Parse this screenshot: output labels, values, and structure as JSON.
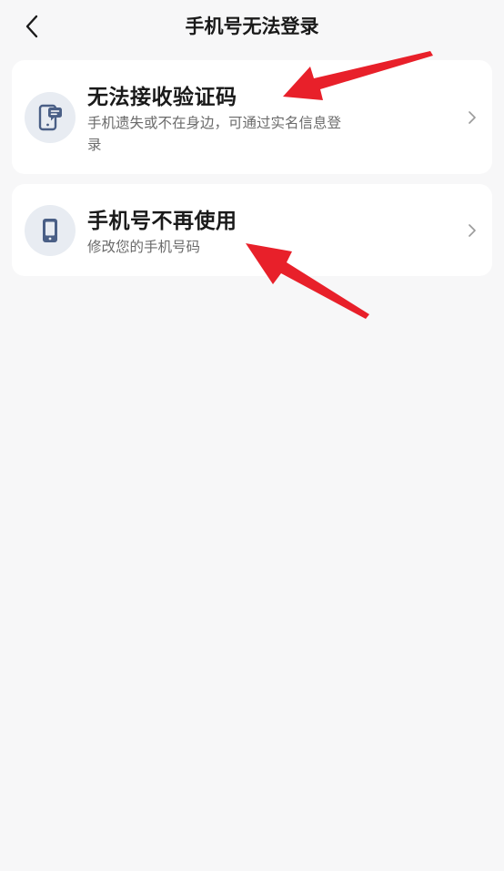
{
  "header": {
    "title": "手机号无法登录"
  },
  "options": [
    {
      "title": "无法接收验证码",
      "description": "手机遗失或不在身边，可通过实名信息登录",
      "icon": "phone-message-icon"
    },
    {
      "title": "手机号不再使用",
      "description": "修改您的手机号码",
      "icon": "phone-icon"
    }
  ],
  "colors": {
    "background": "#f7f7f8",
    "card": "#ffffff",
    "icon_bg": "#e8ecf2",
    "icon_fg": "#4a5f86",
    "annotation_arrow": "#e8202a"
  }
}
